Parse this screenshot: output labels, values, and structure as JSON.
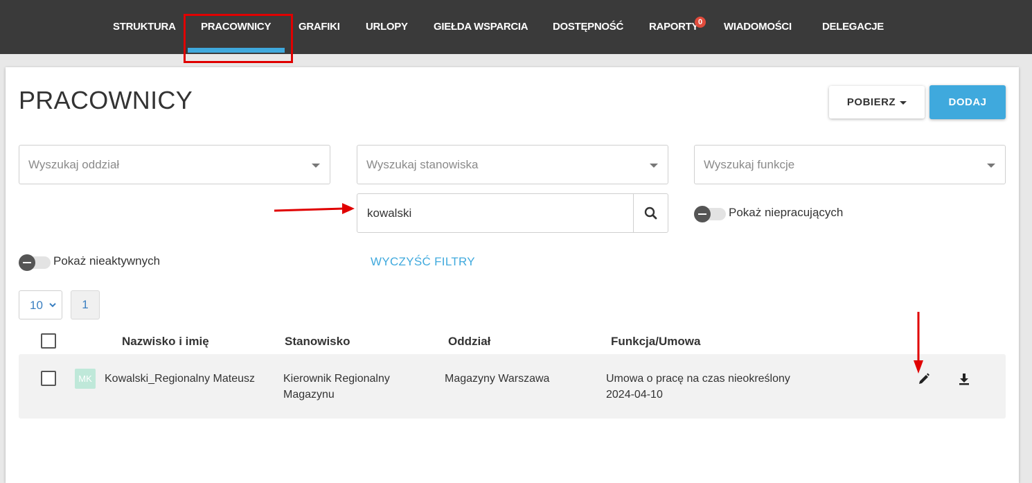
{
  "nav": {
    "items": [
      "STRUKTURA",
      "PRACOWNICY",
      "GRAFIKI",
      "URLOPY",
      "GIEŁDA WSPARCIA",
      "DOSTĘPNOŚĆ",
      "RAPORTY",
      "WIADOMOŚCI",
      "DELEGACJE"
    ],
    "active": "PRACOWNICY",
    "reports_badge": "0"
  },
  "colors": {
    "nav_bg": "#3a3a3a",
    "accent": "#3fa9dd",
    "annotation": "#e00000",
    "badge": "#e04b3c"
  },
  "page": {
    "title": "PRACOWNICY",
    "download_button": "POBIERZ",
    "add_button": "DODAJ"
  },
  "filters": {
    "branch_placeholder": "Wyszukaj oddział",
    "position_placeholder": "Wyszukaj stanowiska",
    "function_placeholder": "Wyszukaj funkcje",
    "search_value": "kowalski",
    "show_not_working": "Pokaż niepracujących",
    "show_inactive": "Pokaż nieaktywnych",
    "clear_filters": "WYCZYŚĆ FILTRY"
  },
  "pagination": {
    "page_size": "10",
    "current_page": "1"
  },
  "table": {
    "headers": [
      "Nazwisko i imię",
      "Stanowisko",
      "Oddział",
      "Funkcja/Umowa"
    ],
    "rows": [
      {
        "initials": "MK",
        "name": "Kowalski_Regionalny Mateusz",
        "position_line1": "Kierownik Regionalny",
        "position_line2": "Magazynu",
        "branch": "Magazyny Warszawa",
        "contract": "Umowa o pracę na czas nieokreślony",
        "date": "2024-04-10"
      }
    ]
  }
}
